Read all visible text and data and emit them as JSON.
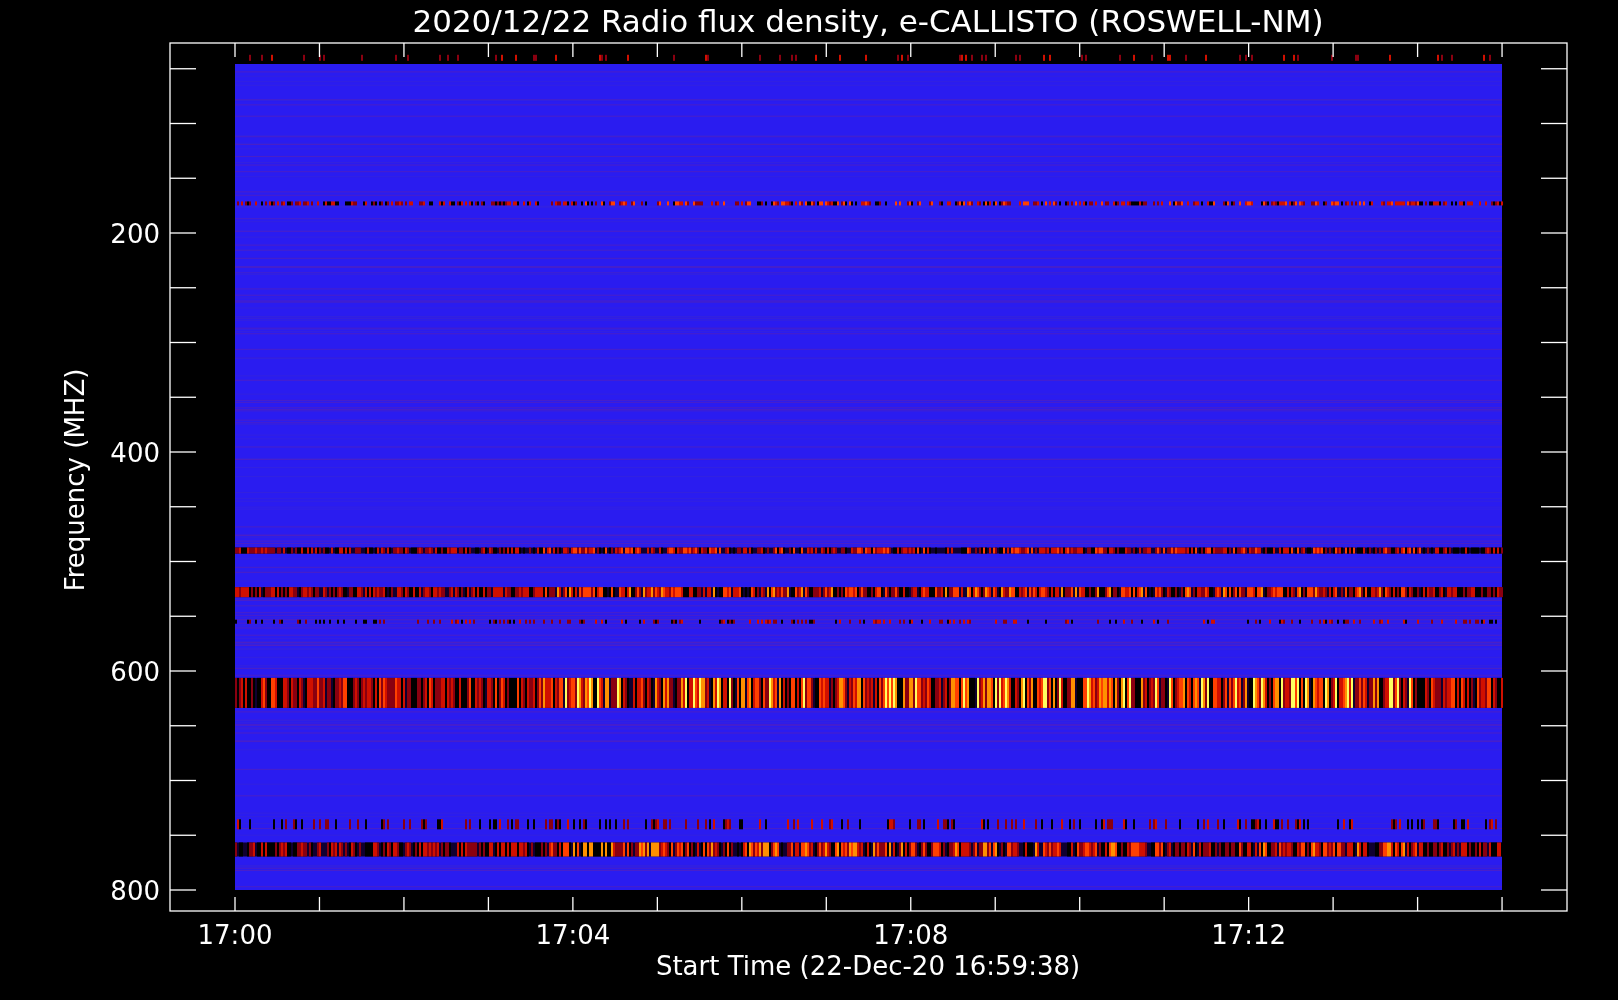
{
  "title": "2020/12/22  Radio flux density, e-CALLISTO (ROSWELL-NM)",
  "y_axis": {
    "label": "Frequency (MHZ)",
    "ticks": [
      "200",
      "400",
      "600",
      "800"
    ]
  },
  "x_axis": {
    "label": "Start Time (22-Dec-20 16:59:38)",
    "ticks": [
      "17:00",
      "17:04",
      "17:08",
      "17:12"
    ]
  }
}
